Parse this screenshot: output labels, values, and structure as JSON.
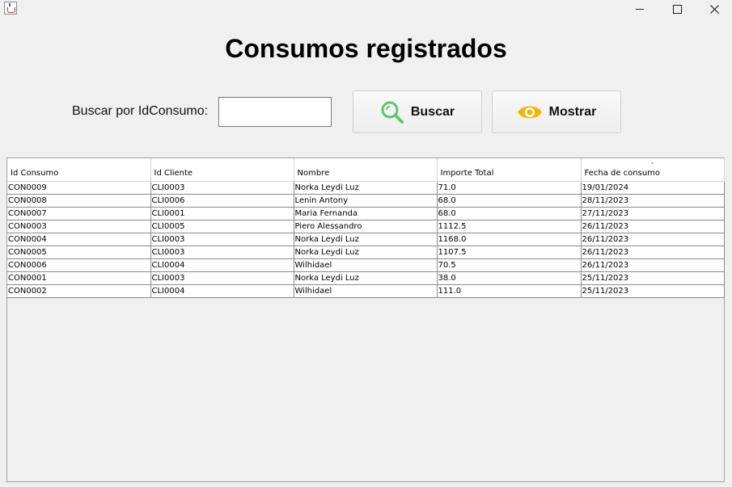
{
  "window": {
    "app_icon": "java-cup-icon",
    "controls": [
      "minimize-icon",
      "maximize-icon",
      "close-icon"
    ]
  },
  "heading": "Consumos registrados",
  "search": {
    "label": "Buscar por IdConsumo:",
    "value": "",
    "buscar_label": "Buscar",
    "buscar_icon": "magnifier-icon",
    "mostrar_label": "Mostrar",
    "mostrar_icon": "eye-icon"
  },
  "colors": {
    "buscar_icon": "#5cc86a",
    "mostrar_icon": "#f2b705"
  },
  "table": {
    "columns": [
      "Id Consumo",
      "Id Cliente",
      "Nombre",
      "Importe Total",
      "Fecha de consumo"
    ],
    "sorted_column": "Fecha de consumo",
    "rows": [
      [
        "CON0009",
        "CLI0003",
        "Norka Leydi Luz",
        "71.0",
        "19/01/2024"
      ],
      [
        "CON0008",
        "CLI0006",
        "Lenin Antony",
        "68.0",
        "28/11/2023"
      ],
      [
        "CON0007",
        "CLI0001",
        "Maria Fernanda",
        "68.0",
        "27/11/2023"
      ],
      [
        "CON0003",
        "CLI0005",
        "Piero Alessandro",
        "1112.5",
        "26/11/2023"
      ],
      [
        "CON0004",
        "CLI0003",
        "Norka Leydi Luz",
        "1168.0",
        "26/11/2023"
      ],
      [
        "CON0005",
        "CLI0003",
        "Norka Leydi Luz",
        "1107.5",
        "26/11/2023"
      ],
      [
        "CON0006",
        "CLI0004",
        "Wilhidael",
        "70.5",
        "26/11/2023"
      ],
      [
        "CON0001",
        "CLI0003",
        "Norka Leydi Luz",
        "38.0",
        "25/11/2023"
      ],
      [
        "CON0002",
        "CLI0004",
        "Wilhidael",
        "111.0",
        "25/11/2023"
      ]
    ]
  }
}
